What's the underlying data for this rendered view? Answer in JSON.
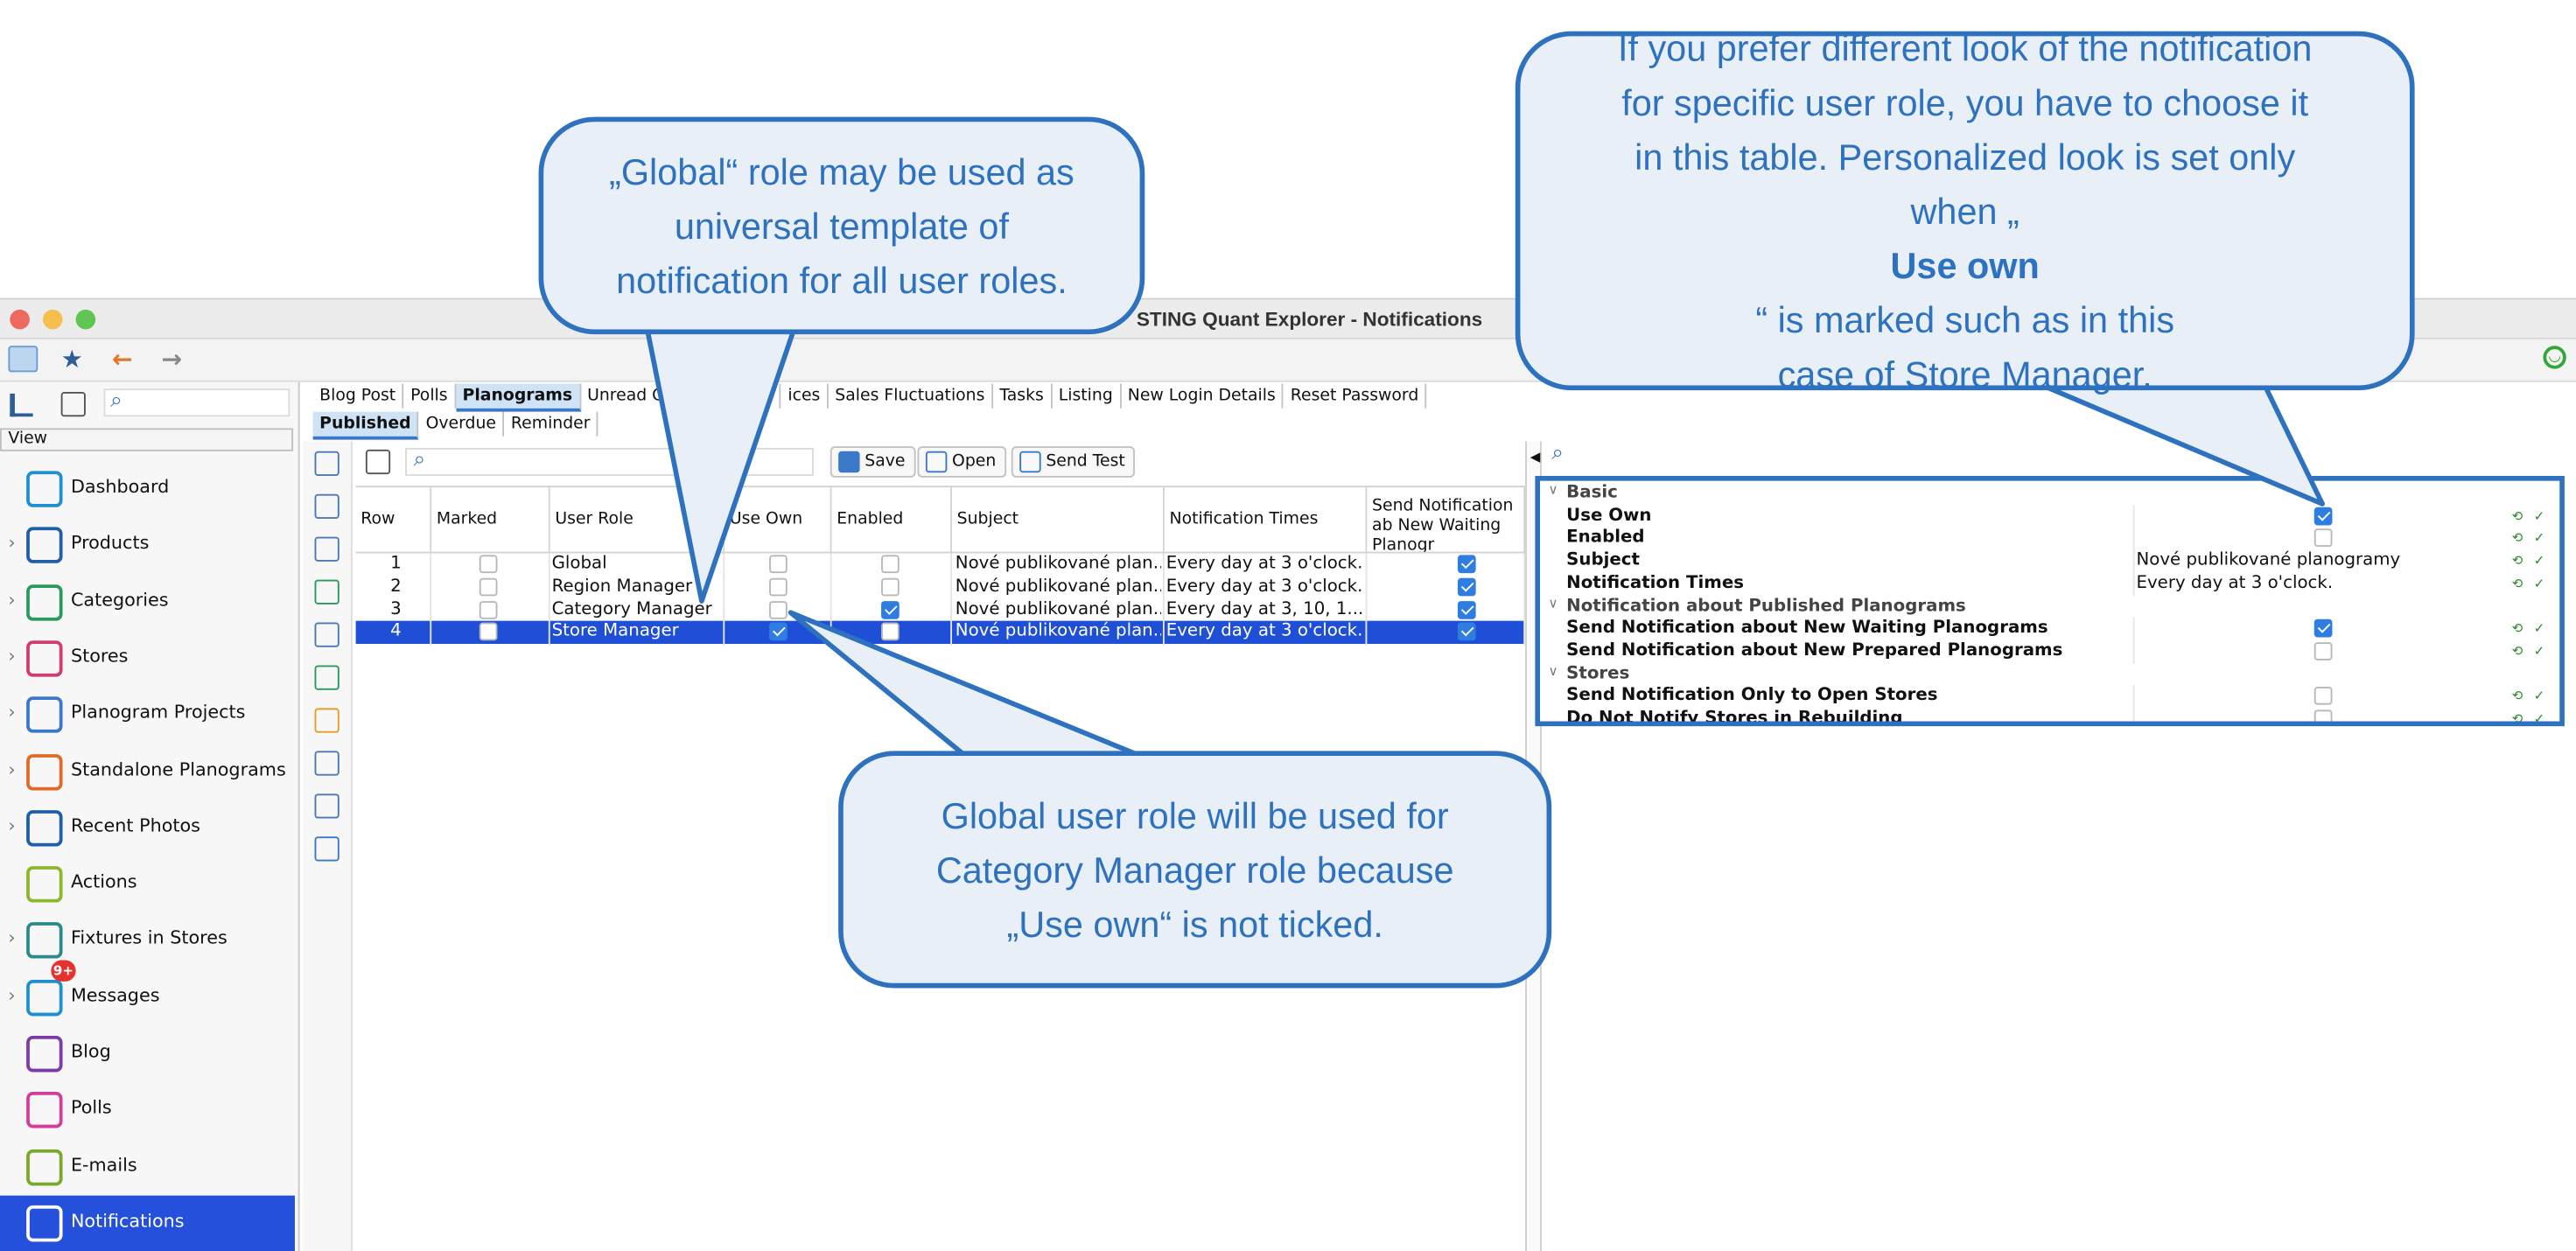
{
  "window": {
    "title": "STING Quant Explorer - Notifications"
  },
  "sidebar": {
    "search_placeholder": "",
    "view_label": "View",
    "badge": "9+",
    "items": [
      {
        "label": "Dashboard",
        "color": "#1f8fd1",
        "chev": ""
      },
      {
        "label": "Products",
        "color": "#1e5fa8",
        "chev": "›"
      },
      {
        "label": "Categories",
        "color": "#2a9a5a",
        "chev": "›"
      },
      {
        "label": "Stores",
        "color": "#d23c6a",
        "chev": "›"
      },
      {
        "label": "Planogram Projects",
        "color": "#3a78c9",
        "chev": "›"
      },
      {
        "label": "Standalone Planograms",
        "color": "#e06a2a",
        "chev": "›"
      },
      {
        "label": "Recent Photos",
        "color": "#1e5fa8",
        "chev": "›"
      },
      {
        "label": "Actions",
        "color": "#8ab82a",
        "chev": ""
      },
      {
        "label": "Fixtures in Stores",
        "color": "#2a8a8a",
        "chev": "›"
      },
      {
        "label": "Messages",
        "color": "#1f8fd1",
        "chev": "›"
      },
      {
        "label": "Blog",
        "color": "#7a3aa8",
        "chev": ""
      },
      {
        "label": "Polls",
        "color": "#d23c9a",
        "chev": ""
      },
      {
        "label": "E-mails",
        "color": "#7aa82a",
        "chev": ""
      },
      {
        "label": "Notifications",
        "color": "#ffffff",
        "chev": ""
      }
    ]
  },
  "tabs_top": [
    "Blog Post",
    "Polls",
    "Planograms",
    "Unread Cha",
    "ices",
    "Sales Fluctuations",
    "Tasks",
    "Listing",
    "New Login Details",
    "Reset Password"
  ],
  "tabs_sub": [
    "Published",
    "Overdue",
    "Reminder"
  ],
  "table_toolbar": {
    "save": "Save",
    "open": "Open",
    "send_test": "Send Test"
  },
  "table": {
    "headers": [
      "Row",
      "Marked",
      "User Role",
      "Use Own",
      "Enabled",
      "Subject",
      "Notification Times",
      "Send Notification ab New Waiting Planogr"
    ],
    "rows": [
      {
        "row": "1",
        "marked": false,
        "role": "Global",
        "use_own": false,
        "enabled": false,
        "subject": "Nové publikované plan...",
        "times": "Every day at 3 o'clock.",
        "send": true
      },
      {
        "row": "2",
        "marked": false,
        "role": "Region Manager",
        "use_own": false,
        "enabled": false,
        "subject": "Nové publikované plan...",
        "times": "Every day at 3 o'clock.",
        "send": true
      },
      {
        "row": "3",
        "marked": false,
        "role": "Category Manager",
        "use_own": false,
        "enabled": true,
        "subject": "Nové publikované plan...",
        "times": "Every day at 3, 10, 1...",
        "send": true
      },
      {
        "row": "4",
        "marked": false,
        "role": "Store Manager",
        "use_own": true,
        "enabled": false,
        "subject": "Nové publikované plan...",
        "times": "Every day at 3 o'clock.",
        "send": true
      }
    ]
  },
  "properties": [
    {
      "type": "group",
      "label": "Basic"
    },
    {
      "type": "check",
      "label": "Use Own",
      "checked": true
    },
    {
      "type": "check",
      "label": "Enabled",
      "checked": false
    },
    {
      "type": "text",
      "label": "Subject",
      "value": "Nové publikované planogramy"
    },
    {
      "type": "text",
      "label": "Notification Times",
      "value": "Every day at 3 o'clock."
    },
    {
      "type": "group",
      "label": "Notification about Published Planograms"
    },
    {
      "type": "check",
      "label": "Send Notification about New Waiting Planograms",
      "checked": true
    },
    {
      "type": "check",
      "label": "Send Notification about New Prepared Planograms",
      "checked": false
    },
    {
      "type": "group",
      "label": "Stores"
    },
    {
      "type": "check",
      "label": "Send Notification Only to Open Stores",
      "checked": false
    },
    {
      "type": "check",
      "label": "Do Not Notify Stores in Rebuilding",
      "checked": false
    }
  ],
  "callouts": {
    "global": [
      "„Global“ role may be used as",
      "universal template of",
      "notification for all user roles."
    ],
    "own_lines": [
      "If you prefer different look of the notification",
      "for specific user role, you have to choose it",
      "in this table. Personalized look is set only"
    ],
    "own_l4a": "when „",
    "own_l4b": "Use own",
    "own_l4c": "“ is marked such as in this",
    "own_l5": "case of Store Manager.",
    "category": [
      "Global user role will be used for",
      "Category Manager role because",
      "„Use own“ is not ticked."
    ]
  },
  "colors": {
    "accent": "#2e72bf",
    "selection": "#1f4fd6",
    "callout_fill": "#e8eff7"
  }
}
